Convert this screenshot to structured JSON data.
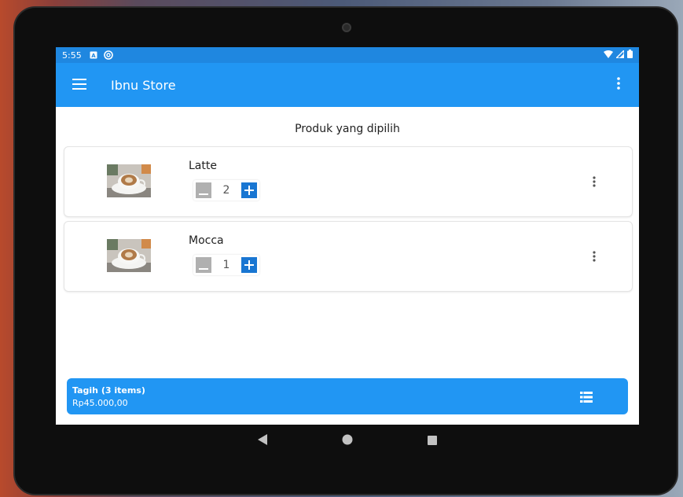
{
  "status_bar": {
    "time": "5:55"
  },
  "app_bar": {
    "title": "Ibnu Store"
  },
  "section_title": "Produk yang dipilih",
  "products": [
    {
      "name": "Latte",
      "quantity": "2"
    },
    {
      "name": "Mocca",
      "quantity": "1"
    }
  ],
  "checkout": {
    "label": "Tagih (3 items)",
    "total": "Rp45.000,00"
  },
  "colors": {
    "primary": "#2196f3",
    "status_bar": "#1f87e0",
    "plus_button": "#1976d2",
    "minus_button": "#b0b0b0"
  },
  "icons": [
    "menu-icon",
    "overflow-menu-icon",
    "list-icon",
    "back-icon",
    "home-icon",
    "recents-icon"
  ]
}
